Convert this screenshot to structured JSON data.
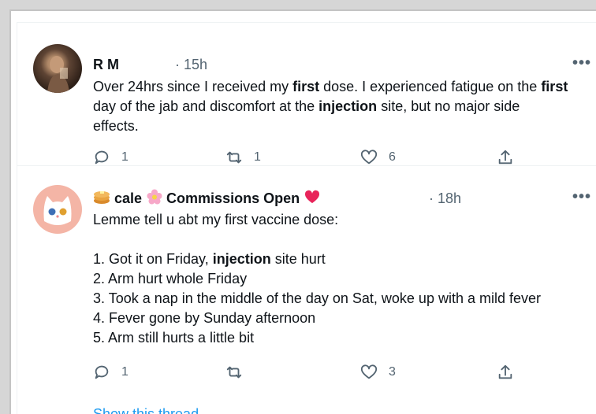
{
  "tweets": [
    {
      "name": "R M",
      "time": "· 15h",
      "more": "•••",
      "lines": [
        [
          {
            "t": "Over 24hrs since I received my "
          },
          {
            "t": "first",
            "b": true
          },
          {
            "t": " dose. I experienced fatigue on the "
          },
          {
            "t": "first",
            "b": true
          }
        ],
        [
          {
            "t": "day of the jab and discomfort at the "
          },
          {
            "t": "injection",
            "b": true
          },
          {
            "t": " site, but no major side"
          }
        ],
        [
          {
            "t": "effects."
          }
        ]
      ],
      "reply_count": "1",
      "retweet_count": "1",
      "like_count": "6"
    },
    {
      "name_part1": "cale",
      "name_part2": "Commissions Open",
      "time": "· 18h",
      "more": "•••",
      "lines": [
        [
          {
            "t": "Lemme tell u abt my first vaccine dose:"
          }
        ],
        [
          {
            "t": ""
          }
        ],
        [
          {
            "t": "1. Got it on Friday, "
          },
          {
            "t": "injection",
            "b": true
          },
          {
            "t": " site hurt"
          }
        ],
        [
          {
            "t": "2. Arm hurt whole Friday"
          }
        ],
        [
          {
            "t": "3. Took a nap in the middle of the day on Sat, woke up with a mild fever"
          }
        ],
        [
          {
            "t": "4. Fever gone by Sunday afternoon"
          }
        ],
        [
          {
            "t": "5. Arm still hurts a little bit"
          }
        ]
      ],
      "reply_count": "1",
      "retweet_count": "",
      "like_count": "3",
      "show_thread": "Show this thread"
    }
  ],
  "icons": {
    "reply": "reply-icon",
    "retweet": "retweet-icon",
    "like": "heart-icon",
    "share": "share-icon",
    "more": "more-icon"
  },
  "colors": {
    "text": "#0f1419",
    "secondary": "#536471",
    "link": "#1d9bf0",
    "divider": "#eff3f4"
  }
}
